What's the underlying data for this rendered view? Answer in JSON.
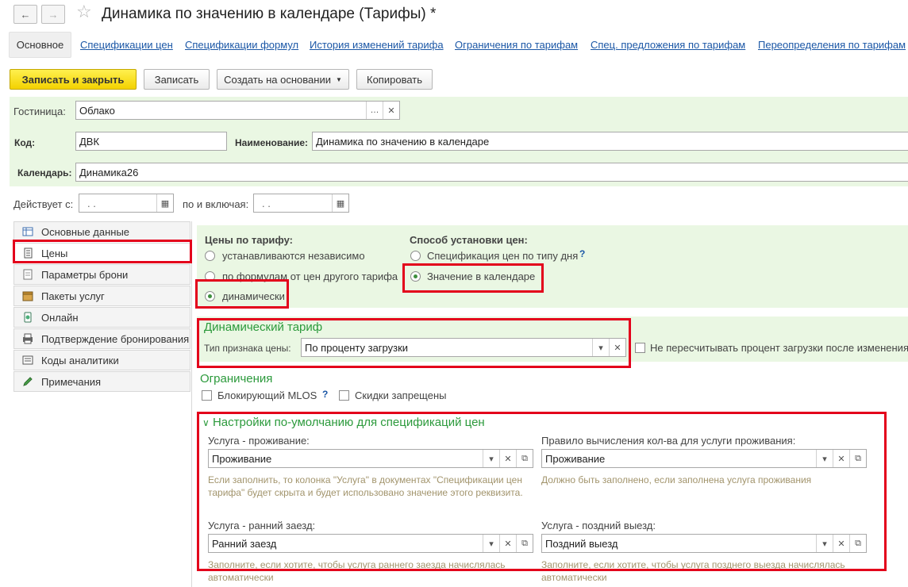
{
  "window": {
    "title": "Динамика по значению в календаре (Тарифы) *"
  },
  "tabs": [
    "Основное",
    "Спецификации цен",
    "Спецификации формул",
    "История изменений тарифа",
    "Ограничения по тарифам",
    "Спец. предложения по тарифам",
    "Переопределения по тарифам"
  ],
  "toolbar": {
    "save_close": "Записать и закрыть",
    "save": "Записать",
    "create_based": "Создать на основании",
    "copy": "Копировать"
  },
  "form": {
    "hotel_label": "Гостиница:",
    "hotel_value": "Облако",
    "code_label": "Код:",
    "code_value": "ДВК",
    "name_label": "Наименование:",
    "name_value": "Динамика по значению в календаре",
    "calendar_label": "Календарь:",
    "calendar_value": "Динамика26",
    "valid_from_label": "Действует с:",
    "valid_from_value": " .  . ",
    "valid_to_label": "по и включая:",
    "valid_to_value": " .  . "
  },
  "sidebar": [
    {
      "label": "Основные данные",
      "icon": "table-icon"
    },
    {
      "label": "Цены",
      "icon": "price-list-icon"
    },
    {
      "label": "Параметры брони",
      "icon": "document-icon"
    },
    {
      "label": "Пакеты услуг",
      "icon": "package-icon"
    },
    {
      "label": "Онлайн",
      "icon": "online-icon"
    },
    {
      "label": "Подтверждение бронирования",
      "icon": "printer-icon"
    },
    {
      "label": "Коды аналитики",
      "icon": "codes-icon"
    },
    {
      "label": "Примечания",
      "icon": "pencil-icon"
    }
  ],
  "prices": {
    "header": "Цены по тарифу:",
    "options": [
      "устанавливаются независимо",
      "по формулам от цен другого тарифа",
      "динамически"
    ],
    "selected": 2,
    "method_header": "Способ установки цен:",
    "method_options": [
      "Спецификация цен по типу дня",
      "Значение в календаре"
    ],
    "method_selected": 1,
    "help": "?"
  },
  "dynamic": {
    "title": "Динамический тариф",
    "type_label": "Тип признака цены:",
    "type_value": "По проценту загрузки",
    "no_recalc": "Не пересчитывать процент загрузки после изменения"
  },
  "restrictions": {
    "title": "Ограничения",
    "blocking_mlos": "Блокирующий MLOS",
    "help": "?",
    "no_discounts": "Скидки запрещены"
  },
  "defaults": {
    "title": "Настройки по-умолчанию для спецификаций цен",
    "service_stay_label": "Услуга - проживание:",
    "service_stay_value": "Проживание",
    "service_stay_hint": "Если заполнить, то колонка \"Услуга\" в документах \"Спецификации цен тарифа\" будет скрыта и будет использовано значение этого реквизита.",
    "rule_label": "Правило вычисления кол-ва для услуги проживания:",
    "rule_value": "Проживание",
    "rule_hint": "Должно быть заполнено, если заполнена услуга проживания",
    "early_label": "Услуга - ранний заезд:",
    "early_value": "Ранний заезд",
    "early_hint": "Заполните, если хотите, чтобы услуга раннего заезда начислялась автоматически",
    "late_label": "Услуга - поздний выезд:",
    "late_value": "Поздний выезд",
    "late_hint": "Заполните, если хотите, чтобы услуга позднего выезда начислялась автоматически"
  },
  "colors": {
    "accent_red": "#e3001b",
    "section_green": "#2c9a3c",
    "panel_green": "#eaf7e3",
    "link_blue": "#1b57a6"
  }
}
